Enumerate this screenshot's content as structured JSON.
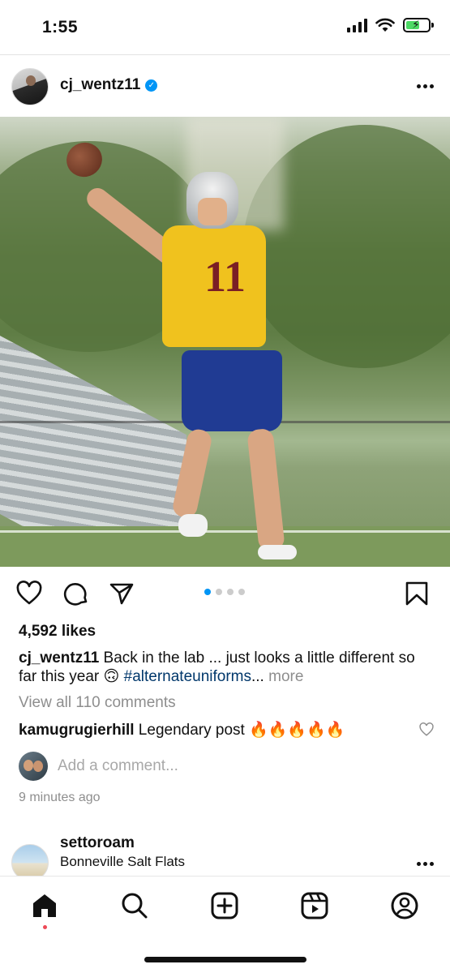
{
  "status_bar": {
    "time": "1:55"
  },
  "post": {
    "username": "cj_wentz11",
    "verified": true,
    "image_alt_subject": "quarterback in yellow #11 practice jersey throwing a football",
    "jersey_number": "11",
    "carousel": {
      "count": 4,
      "active_index": 0
    },
    "likes": "4,592 likes",
    "caption": {
      "username": "cj_wentz11",
      "text": " Back in the lab ... just looks a little different so far this year 🙃 ",
      "hashtag": "#alternateuniforms",
      "ellipsis": "...",
      "more": " more"
    },
    "view_comments": "View all 110 comments",
    "top_comment": {
      "username": "kamugrugierhill",
      "text": " Legendary post 🔥🔥🔥🔥🔥"
    },
    "add_comment_placeholder": "Add a comment...",
    "timestamp": "9 minutes ago"
  },
  "next_post": {
    "username": "settoroam",
    "location": "Bonneville Salt Flats"
  },
  "colors": {
    "accent_blue": "#0095f6",
    "hashtag": "#00376b",
    "muted_text": "#8e8e8e",
    "notification_dot": "#ed4956"
  },
  "icons": {
    "status": [
      "signal-icon",
      "wifi-icon",
      "battery-charging-icon"
    ],
    "actions": [
      "heart-icon",
      "comment-icon",
      "share-icon",
      "bookmark-icon"
    ],
    "tabs": [
      "home-icon",
      "search-icon",
      "create-icon",
      "reels-icon",
      "profile-icon"
    ]
  }
}
